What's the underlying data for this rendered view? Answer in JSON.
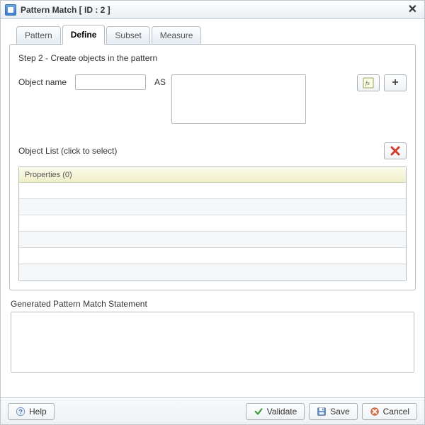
{
  "window": {
    "title": "Pattern Match [ ID : 2 ]"
  },
  "tabs": [
    {
      "label": "Pattern",
      "active": false
    },
    {
      "label": "Define",
      "active": true
    },
    {
      "label": "Subset",
      "active": false
    },
    {
      "label": "Measure",
      "active": false
    }
  ],
  "step": {
    "title": "Step 2 - Create objects in the pattern"
  },
  "form": {
    "object_name_label": "Object name",
    "object_name_value": "",
    "as_label": "AS",
    "as_value": ""
  },
  "objlist": {
    "header": "Object List (click to select)",
    "properties_header": "Properties (0)",
    "rows": [
      "",
      "",
      "",
      "",
      "",
      ""
    ]
  },
  "generated": {
    "label": "Generated Pattern Match Statement",
    "value": ""
  },
  "footer": {
    "help": "Help",
    "validate": "Validate",
    "save": "Save",
    "cancel": "Cancel"
  }
}
